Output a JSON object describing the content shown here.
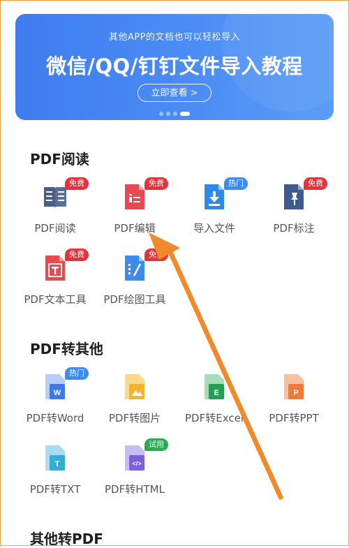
{
  "banner": {
    "subtitle": "其他APP的文档也可以轻松导入",
    "title": "微信/QQ/钉钉文件导入教程",
    "cta": "立即查看 >"
  },
  "sections": {
    "read": {
      "title": "PDF阅读"
    },
    "convert": {
      "title": "PDF转其他"
    },
    "to_pdf": {
      "title": "其他转PDF"
    }
  },
  "tools": {
    "pdf_read": {
      "label": "PDF阅读",
      "badge": "免费"
    },
    "pdf_edit": {
      "label": "PDF编辑",
      "badge": "免费"
    },
    "import_file": {
      "label": "导入文件",
      "badge": "热门"
    },
    "pdf_annotate": {
      "label": "PDF标注",
      "badge": "免费"
    },
    "pdf_text": {
      "label": "PDF文本工具",
      "badge": "免费"
    },
    "pdf_draw": {
      "label": "PDF绘图工具",
      "badge": "免费"
    },
    "pdf_word": {
      "label": "PDF转Word",
      "badge": "热门"
    },
    "pdf_image": {
      "label": "PDF转图片"
    },
    "pdf_excel": {
      "label": "PDF转Excel"
    },
    "pdf_ppt": {
      "label": "PDF转PPT"
    },
    "pdf_txt": {
      "label": "PDF转TXT"
    },
    "pdf_html": {
      "label": "PDF转HTML",
      "badge": "试用"
    }
  },
  "colors": {
    "banner": "#4b8cf5",
    "arrow": "#f08a2a",
    "badge_red": "#e8313a",
    "badge_blue": "#3b8cf0",
    "badge_green": "#2eaa57"
  }
}
